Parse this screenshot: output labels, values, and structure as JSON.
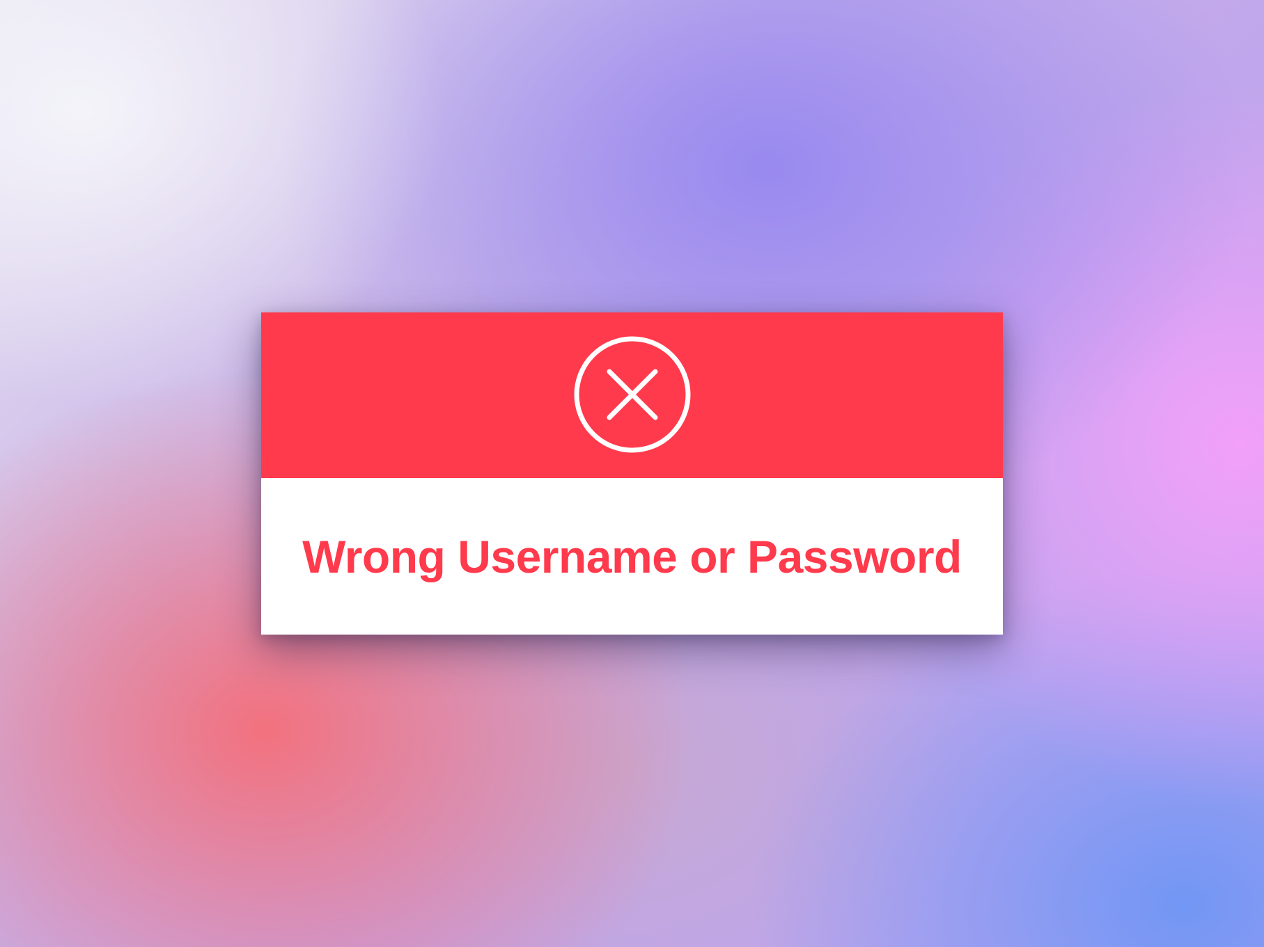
{
  "dialog": {
    "header_color": "#ff3a4c",
    "icon": "close-circle-icon",
    "message": "Wrong Username or Password",
    "message_color": "#ff3a4c"
  }
}
